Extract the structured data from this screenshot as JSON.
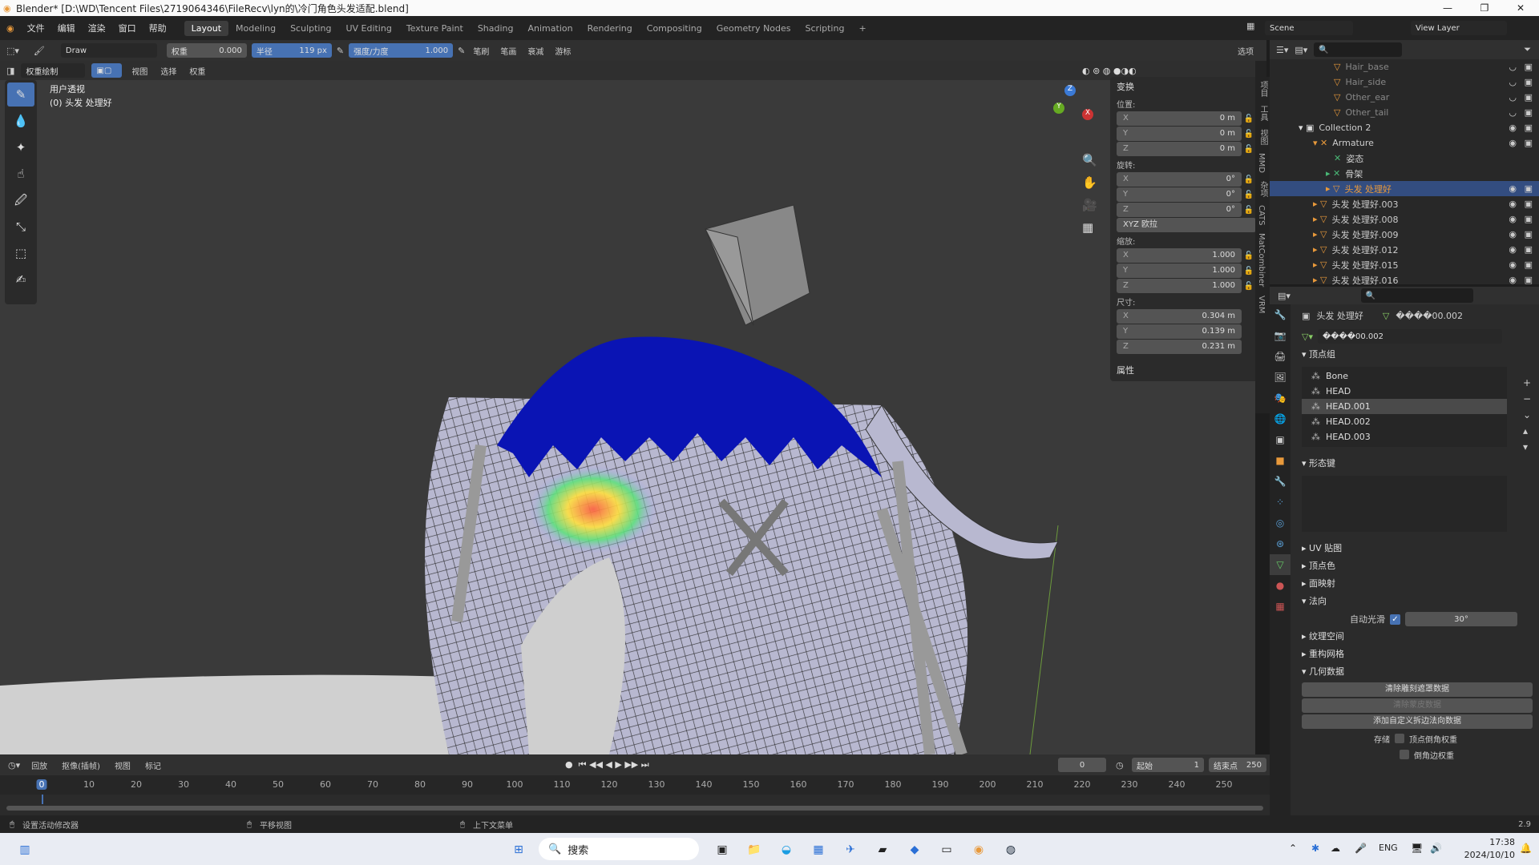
{
  "title": "Blender* [D:\\WD\\Tencent Files\\2719064346\\FileRecv\\lyn的\\冷门角色头发适配.blend]",
  "menus": [
    "文件",
    "编辑",
    "渲染",
    "窗口",
    "帮助"
  ],
  "workspaces": [
    "Layout",
    "Modeling",
    "Sculpting",
    "UV Editing",
    "Texture Paint",
    "Shading",
    "Animation",
    "Rendering",
    "Compositing",
    "Geometry Nodes",
    "Scripting"
  ],
  "active_workspace": "Layout",
  "scene": "Scene",
  "view_layer": "View Layer",
  "tool_header": {
    "brush": "Draw",
    "weight_label": "权重",
    "weight_value": "0.000",
    "radius_label": "半径",
    "radius_value": "119 px",
    "strength_label": "强度/力度",
    "strength_value": "1.000",
    "menus": [
      "笔刷",
      "笔画",
      "衰减",
      "游标"
    ],
    "options": "选项"
  },
  "viewport_header": {
    "mode": "权重绘制",
    "menus": [
      "视图",
      "选择",
      "权重"
    ]
  },
  "viewport": {
    "view_name": "用户透视",
    "object_label": "(0) 头发 处理好"
  },
  "npanel": {
    "transform": "变换",
    "location": "位置:",
    "rotation": "旋转:",
    "rotation_mode": "XYZ 欧拉",
    "scale": "缩放:",
    "dimensions": "尺寸:",
    "loc": [
      {
        "axis": "X",
        "value": "0 m"
      },
      {
        "axis": "Y",
        "value": "0 m"
      },
      {
        "axis": "Z",
        "value": "0 m"
      }
    ],
    "rot": [
      {
        "axis": "X",
        "value": "0°"
      },
      {
        "axis": "Y",
        "value": "0°"
      },
      {
        "axis": "Z",
        "value": "0°"
      }
    ],
    "scl": [
      {
        "axis": "X",
        "value": "1.000"
      },
      {
        "axis": "Y",
        "value": "1.000"
      },
      {
        "axis": "Z",
        "value": "1.000"
      }
    ],
    "dim": [
      {
        "axis": "X",
        "value": "0.304 m"
      },
      {
        "axis": "Y",
        "value": "0.139 m"
      },
      {
        "axis": "Z",
        "value": "0.231 m"
      }
    ],
    "properties": "属性"
  },
  "side_tabs": [
    "项目",
    "工具",
    "视图",
    "MMD",
    "杂项",
    "CATS",
    "MatCombiner",
    "VRM"
  ],
  "outliner": [
    {
      "name": "Hair_base",
      "dim": true
    },
    {
      "name": "Hair_side",
      "dim": true
    },
    {
      "name": "Other_ear",
      "dim": true
    },
    {
      "name": "Other_tail",
      "dim": true
    },
    {
      "name": "Collection 2"
    },
    {
      "name": "Armature"
    },
    {
      "name": "姿态"
    },
    {
      "name": "骨架"
    },
    {
      "name": "头发 处理好",
      "selected": true
    },
    {
      "name": "头发 处理好.003"
    },
    {
      "name": "头发 处理好.008"
    },
    {
      "name": "头发 处理好.009"
    },
    {
      "name": "头发 处理好.012"
    },
    {
      "name": "头发 处理好.015"
    },
    {
      "name": "头发 处理好.016"
    }
  ],
  "properties": {
    "object": "头发 处理好",
    "mesh": "����00.002",
    "mesh_field": "����00.002",
    "vertex_groups_title": "顶点组",
    "vertex_groups": [
      {
        "name": "Bone"
      },
      {
        "name": "HEAD"
      },
      {
        "name": "HEAD.001",
        "selected": true
      },
      {
        "name": "HEAD.002"
      },
      {
        "name": "HEAD.003"
      }
    ],
    "shape_keys": "形态键",
    "uv_maps": "UV 贴图",
    "vertex_colors": "顶点色",
    "face_maps": "面映射",
    "normals": "法向",
    "auto_smooth": "自动光滑",
    "auto_smooth_angle": "30°",
    "texture_space": "纹理空间",
    "remesh": "重构网格",
    "geometry_data": "几何数据",
    "btn_clear_sculpt": "清除雕刻遮罩数据",
    "btn_clear_skin": "清除蒙皮数据",
    "btn_add_custom": "添加自定义拆边法向数据",
    "store_label": "存储",
    "store_vertex_bevel": "顶点倒角权重",
    "store_edge_bevel": "倒角边权重"
  },
  "timeline": {
    "menus": [
      "回放",
      "抠像(插帧)",
      "视图",
      "标记"
    ],
    "current_frame": "0",
    "start_label": "起始",
    "start": "1",
    "end_label": "结束点",
    "end": "250",
    "ticks": [
      "0",
      "10",
      "20",
      "30",
      "40",
      "50",
      "60",
      "70",
      "80",
      "90",
      "100",
      "110",
      "120",
      "130",
      "140",
      "150",
      "160",
      "170",
      "180",
      "190",
      "200",
      "210",
      "220",
      "230",
      "240",
      "250"
    ]
  },
  "status": [
    "设置活动修改器",
    "平移视图",
    "上下文菜单"
  ],
  "version": "2.9",
  "taskbar": {
    "search": "搜索",
    "lang": "ENG",
    "time": "17:38",
    "date": "2024/10/10"
  }
}
